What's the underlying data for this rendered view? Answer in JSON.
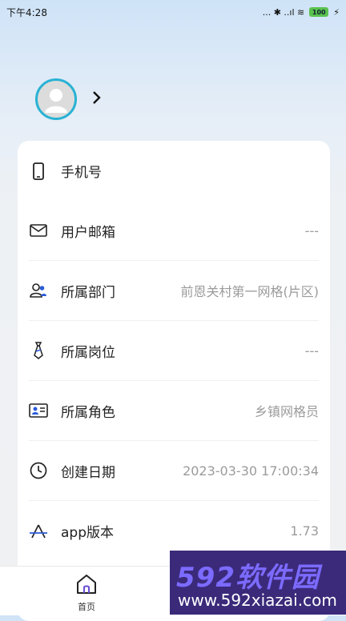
{
  "status_bar": {
    "time": "下午4:28",
    "indicators": "... ✱ ..ıl ≋",
    "battery": "100",
    "charging": "⚡"
  },
  "profile": {
    "avatar_icon": "user-avatar-icon",
    "chevron": "›"
  },
  "info_rows": [
    {
      "icon": "phone-icon",
      "label": "手机号",
      "value": ""
    },
    {
      "icon": "mail-icon",
      "label": "用户邮箱",
      "value": "---"
    },
    {
      "icon": "users-icon",
      "label": "所属部门",
      "value": "前恩关村第一网格(片区)"
    },
    {
      "icon": "tie-icon",
      "label": "所属岗位",
      "value": "---"
    },
    {
      "icon": "id-card-icon",
      "label": "所属角色",
      "value": "乡镇网格员"
    },
    {
      "icon": "clock-icon",
      "label": "创建日期",
      "value": "2023-03-30 17:00:34"
    },
    {
      "icon": "app-icon",
      "label": "app版本",
      "value": "1.73"
    }
  ],
  "tabbar": {
    "home_label": "首页"
  },
  "watermark": {
    "brand": "592软件园",
    "url": "www.592xiazai.com"
  },
  "colors": {
    "accent": "#28b2d3",
    "value_gray": "#9b9b9b"
  }
}
